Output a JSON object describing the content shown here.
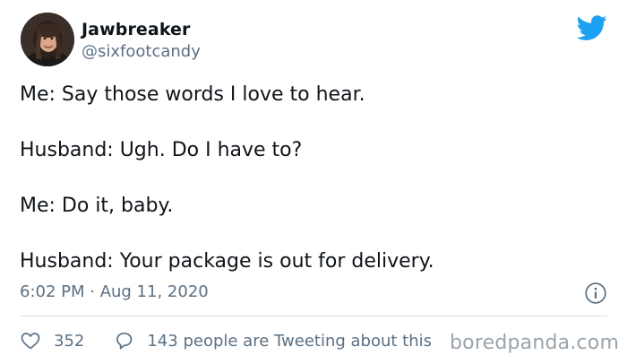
{
  "author": {
    "display_name": "Jawbreaker",
    "handle": "@sixfootcandy",
    "avatar_icon": "profile-photo"
  },
  "brand": {
    "icon": "twitter-bird-icon",
    "color": "#1da1f2"
  },
  "tweet": {
    "lines": [
      "Me: Say those words I love to hear.",
      "Husband: Ugh. Do I have to?",
      "Me: Do it, baby.",
      "Husband: Your package is out for delivery."
    ],
    "timestamp": "6:02 PM · Aug 11, 2020"
  },
  "actions": {
    "like_count": "352",
    "reply_text": "143 people are Tweeting about this"
  },
  "watermark": "boredpanda.com"
}
